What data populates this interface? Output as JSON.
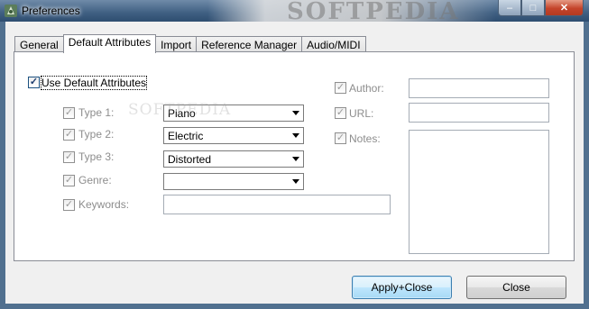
{
  "window": {
    "title": "Preferences",
    "watermark": "SOFTPEDIA",
    "controls": {
      "minimize": "–",
      "maximize": "□",
      "close": "✕"
    }
  },
  "tabs": [
    {
      "label": "General",
      "active": false
    },
    {
      "label": "Default Attributes",
      "active": true
    },
    {
      "label": "Import",
      "active": false
    },
    {
      "label": "Reference Manager",
      "active": false
    },
    {
      "label": "Audio/MIDI",
      "active": false
    }
  ],
  "panel": {
    "use_default": {
      "label": "Use Default Attributes",
      "checked": true
    },
    "fields": {
      "type1": {
        "label": "Type 1:",
        "value": "Piano",
        "checked": true
      },
      "type2": {
        "label": "Type 2:",
        "value": "Electric",
        "checked": true
      },
      "type3": {
        "label": "Type 3:",
        "value": "Distorted",
        "checked": true
      },
      "genre": {
        "label": "Genre:",
        "value": "",
        "checked": true
      },
      "keywords": {
        "label": "Keywords:",
        "value": "",
        "checked": true
      },
      "author": {
        "label": "Author:",
        "value": "",
        "checked": true
      },
      "url": {
        "label": "URL:",
        "value": "",
        "checked": true
      },
      "notes": {
        "label": "Notes:",
        "value": "",
        "checked": true
      }
    },
    "watermark": "SOFTPEDIA"
  },
  "buttons": {
    "apply": "Apply+Close",
    "close": "Close"
  },
  "colors": {
    "accent": "#3c7fb1",
    "frame": "#51708f"
  }
}
